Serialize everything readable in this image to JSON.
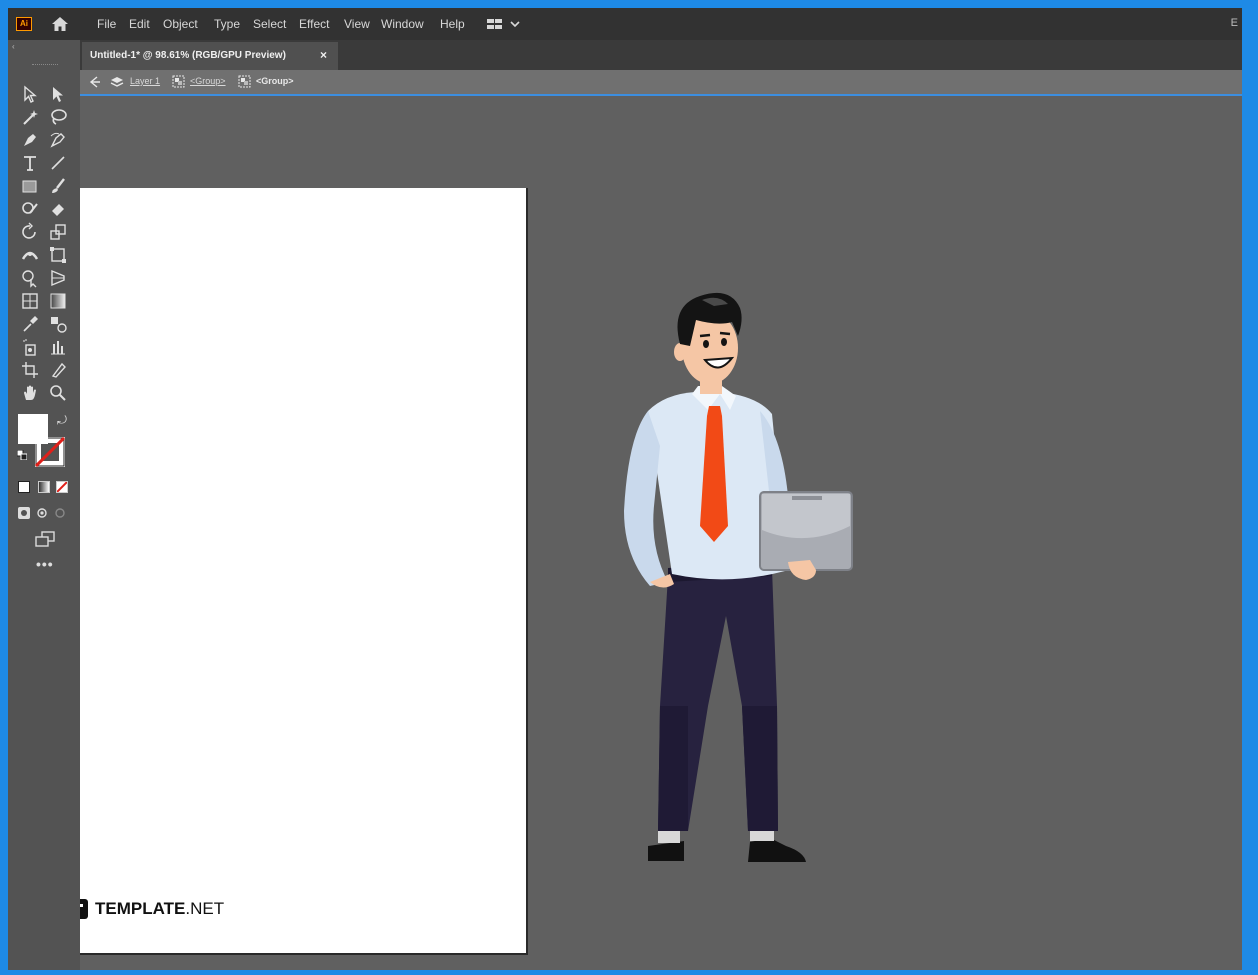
{
  "app": {
    "logo_text": "Ai",
    "logo_icon": "illustrator-logo-icon"
  },
  "menu": {
    "items": [
      "File",
      "Edit",
      "Object",
      "Type",
      "Select",
      "Effect",
      "View",
      "Window",
      "Help"
    ],
    "edge_label": "E"
  },
  "document": {
    "tab_title": "Untitled-1* @ 98.61% (RGB/GPU Preview)",
    "tab_close": "×"
  },
  "isolation_bar": {
    "layer": "Layer 1",
    "group_1": "<Group>",
    "group_2": "<Group>"
  },
  "toolbar": {
    "collapse_label": "‹",
    "more_label": "•••",
    "fill_color": "#ffffff",
    "stroke_color": "none",
    "tools": [
      "selection-tool",
      "direct-selection-tool",
      "magic-wand-tool",
      "lasso-tool",
      "pen-tool",
      "curvature-tool",
      "type-tool",
      "line-segment-tool",
      "rectangle-tool",
      "paintbrush-tool",
      "shaper-tool",
      "eraser-tool",
      "rotate-tool",
      "scale-tool",
      "width-tool",
      "free-transform-tool",
      "shape-builder-tool",
      "perspective-grid-tool",
      "mesh-tool",
      "gradient-tool",
      "eyedropper-tool",
      "blend-tool",
      "symbol-sprayer-tool",
      "column-graph-tool",
      "artboard-tool",
      "slice-tool",
      "hand-tool",
      "zoom-tool"
    ]
  },
  "canvas": {
    "background": "#606060",
    "artboard_color": "#ffffff"
  },
  "watermark": {
    "brand": "TEMPLATE",
    "tld": ".NET"
  },
  "colors": {
    "frame_border": "#1e8ae6",
    "menubar": "#323232",
    "toolbar": "#535353",
    "accent_blue": "#3c8ee0",
    "tie": "#f24a16",
    "shirt": "#dce8f5",
    "pants": "#27223f"
  }
}
